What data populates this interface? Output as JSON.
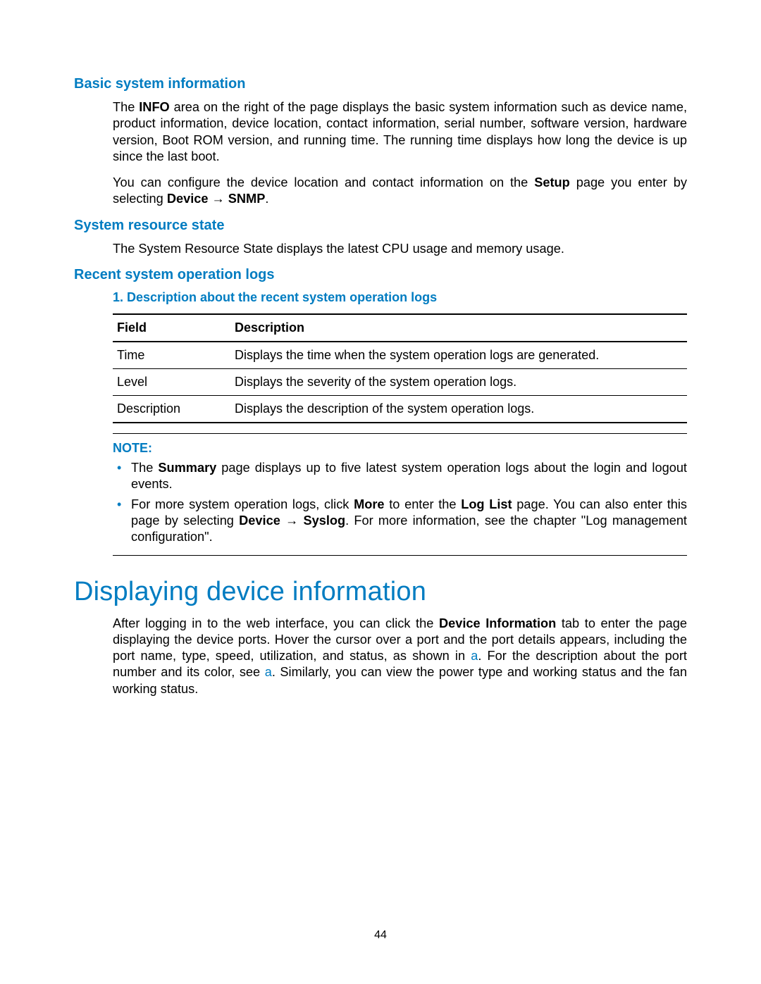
{
  "sections": {
    "basic": {
      "heading": "Basic system information",
      "para1_segments": [
        {
          "t": "The "
        },
        {
          "t": "INFO",
          "b": true
        },
        {
          "t": " area on the right of the page displays the basic system information such as device name, product information, device location, contact information, serial number, software version, hardware version, Boot ROM version, and running time. The running time displays how long the device is up since the last boot."
        }
      ],
      "para2_segments": [
        {
          "t": "You can configure the device location and contact information on the "
        },
        {
          "t": "Setup",
          "b": true
        },
        {
          "t": " page you enter by selecting "
        },
        {
          "t": "Device → SNMP",
          "b": true
        },
        {
          "t": "."
        }
      ]
    },
    "resource": {
      "heading": "System resource state",
      "para": "The System Resource State displays the latest CPU usage and memory usage."
    },
    "logs": {
      "heading": "Recent system operation logs",
      "table_caption_prefix": "1.   ",
      "table_caption": "Description about the recent system operation logs",
      "table": {
        "headers": [
          "Field",
          "Description"
        ],
        "rows": [
          [
            "Time",
            "Displays the time when the system operation logs are generated."
          ],
          [
            "Level",
            "Displays the severity of the system operation logs."
          ],
          [
            "Description",
            "Displays the description of the system operation logs."
          ]
        ]
      },
      "note_label": "NOTE:",
      "note_items": [
        [
          {
            "t": "The "
          },
          {
            "t": "Summary",
            "b": true
          },
          {
            "t": " page displays up to five latest system operation logs about the login and logout events."
          }
        ],
        [
          {
            "t": "For more system operation logs, click "
          },
          {
            "t": "More",
            "b": true
          },
          {
            "t": " to enter the "
          },
          {
            "t": "Log List",
            "b": true
          },
          {
            "t": " page. You can also enter this page by selecting "
          },
          {
            "t": "Device → Syslog",
            "b": true
          },
          {
            "t": ". For more information, see the chapter \"Log management configuration\"."
          }
        ]
      ]
    },
    "device_info": {
      "heading": "Displaying device information",
      "para_segments": [
        {
          "t": "After logging in to the web interface, you can click the "
        },
        {
          "t": "Device Information",
          "b": true
        },
        {
          "t": " tab to enter the page displaying the device ports. Hover the cursor over a port and the port details appears, including the port name, type, speed, utilization, and status, as shown in "
        },
        {
          "t": "a",
          "link": true
        },
        {
          "t": ". For the description about the port number and its color, see "
        },
        {
          "t": "a",
          "link": true
        },
        {
          "t": ". Similarly, you can view the power type and working status and the fan working status."
        }
      ]
    }
  },
  "page_number": "44"
}
